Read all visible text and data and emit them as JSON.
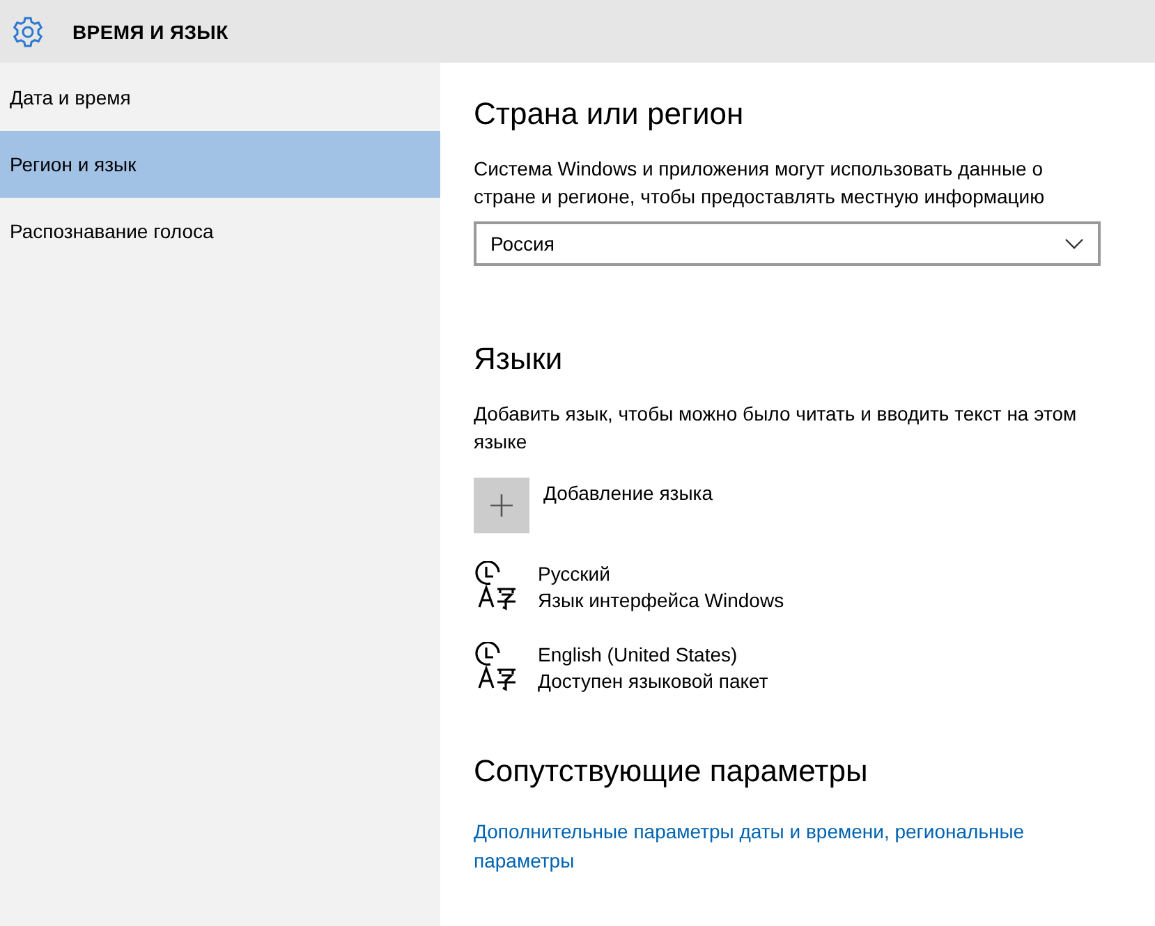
{
  "header": {
    "title": "ВРЕМЯ И ЯЗЫК"
  },
  "sidebar": {
    "items": [
      {
        "label": "Дата и время",
        "selected": false
      },
      {
        "label": "Регион и язык",
        "selected": true
      },
      {
        "label": "Распознавание голоса",
        "selected": false
      }
    ]
  },
  "region": {
    "heading": "Страна или регион",
    "description": "Система Windows и приложения могут использовать данные о стране и регионе, чтобы предоставлять местную информацию",
    "dropdown": {
      "value": "Россия"
    }
  },
  "languages": {
    "heading": "Языки",
    "description": "Добавить язык, чтобы можно было читать и вводить текст на этом языке",
    "add_button": {
      "label": "Добавление языка"
    },
    "items": [
      {
        "name": "Русский",
        "status": "Язык интерфейса Windows"
      },
      {
        "name": "English (United States)",
        "status": "Доступен языковой пакет"
      }
    ]
  },
  "related": {
    "heading": "Сопутствующие параметры",
    "link": "Дополнительные параметры даты и времени, региональные параметры"
  }
}
